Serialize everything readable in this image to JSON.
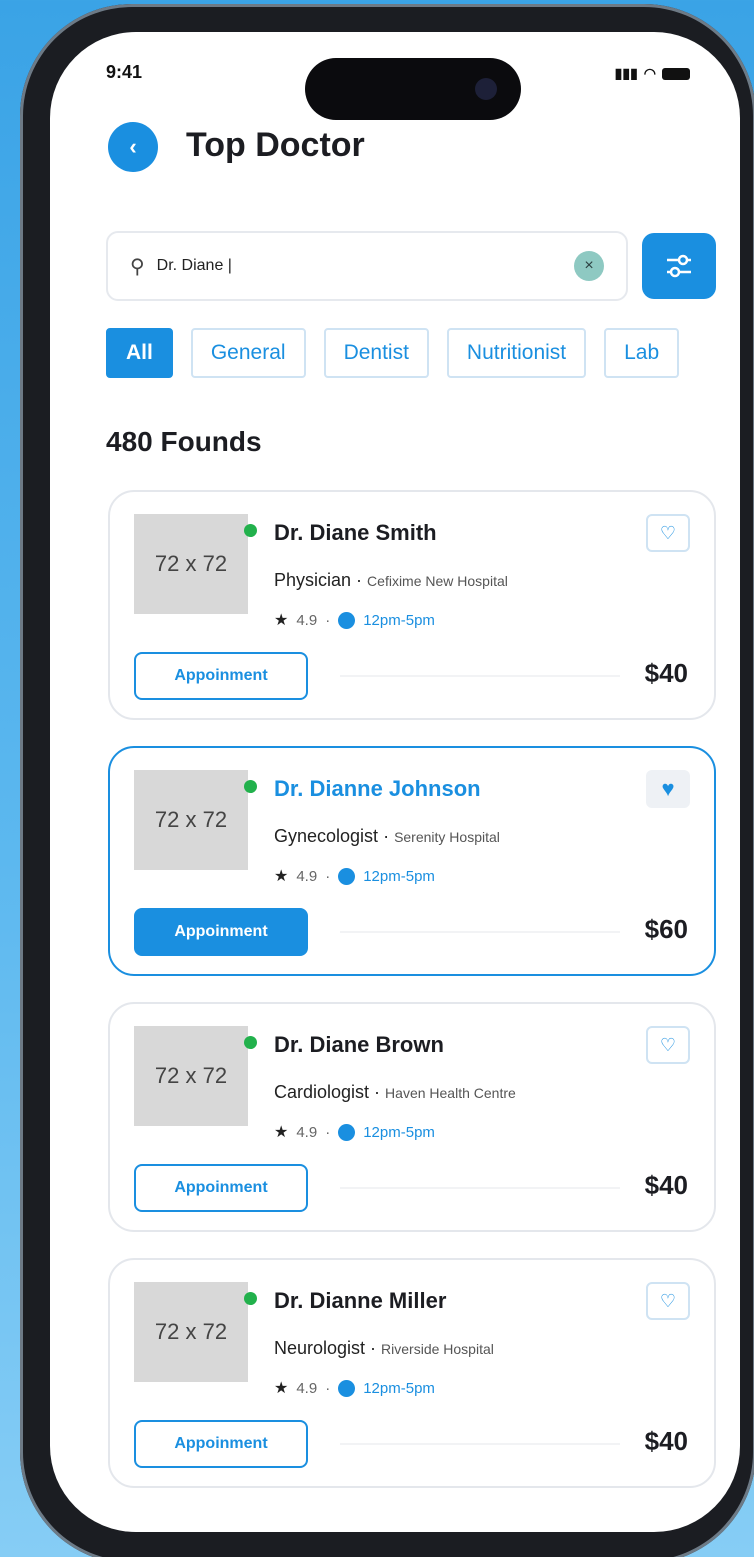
{
  "status": {
    "time": "9:41"
  },
  "header": {
    "title": "Top Doctor",
    "back_icon": "chevron-left-icon"
  },
  "search": {
    "value": "Dr. Diane |"
  },
  "categories": [
    "All",
    "General",
    "Dentist",
    "Nutritionist",
    "Lab"
  ],
  "results": {
    "count_label": "480 Founds"
  },
  "doctors": [
    {
      "photo_label": "72 x 72",
      "name": "Dr. Diane Smith",
      "specialty": "Physician",
      "hospital": "Cefixime New Hospital",
      "rating": "4.9",
      "hours": "12pm-5pm",
      "cta": "Appoinment",
      "price": "$40",
      "favorited": false
    },
    {
      "photo_label": "72 x 72",
      "name": "Dr. Dianne Johnson",
      "specialty": "Gynecologist",
      "hospital": "Serenity Hospital",
      "rating": "4.9",
      "hours": "12pm-5pm",
      "cta": "Appoinment",
      "price": "$60",
      "favorited": true
    },
    {
      "photo_label": "72 x 72",
      "name": "Dr. Diane Brown",
      "specialty": "Cardiologist",
      "hospital": "Haven Health Centre",
      "rating": "4.9",
      "hours": "12pm-5pm",
      "cta": "Appoinment",
      "price": "$40",
      "favorited": false
    },
    {
      "photo_label": "72 x 72",
      "name": "Dr. Dianne Miller",
      "specialty": "Neurologist",
      "hospital": "Riverside Hospital",
      "rating": "4.9",
      "hours": "12pm-5pm",
      "cta": "Appoinment",
      "price": "$40",
      "favorited": false
    }
  ],
  "colors": {
    "accent": "#1a8fe0",
    "online": "#22b14c",
    "background": "#3aa3e6"
  }
}
